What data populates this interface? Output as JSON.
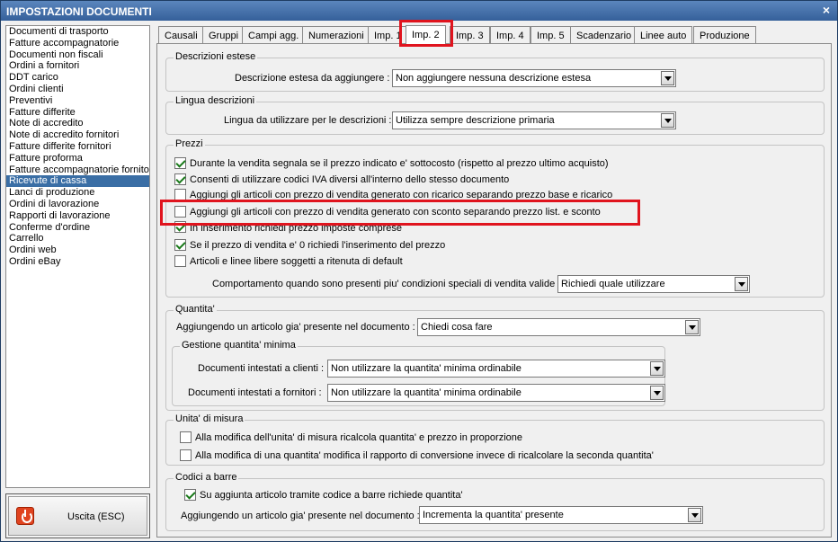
{
  "window": {
    "title": "IMPOSTAZIONI DOCUMENTI",
    "close_glyph": "×"
  },
  "sidebar": {
    "items": [
      "Documenti di trasporto",
      "Fatture accompagnatorie",
      "Documenti non fiscali",
      "Ordini a fornitori",
      "DDT carico",
      "Ordini clienti",
      "Preventivi",
      "Fatture differite",
      "Note di accredito",
      "Note di accredito fornitori",
      "Fatture differite fornitori",
      "Fatture proforma",
      "Fatture accompagnatorie fornito",
      "Ricevute di cassa",
      "Lanci di produzione",
      "Ordini di lavorazione",
      "Rapporti di lavorazione",
      "Conferme d'ordine",
      "Carrello",
      "Ordini web",
      "Ordini eBay"
    ],
    "selected_index": 13
  },
  "exit_button": {
    "label": "Uscita (ESC)",
    "icon": "power-icon"
  },
  "tabs": [
    "Causali",
    "Gruppi",
    "Campi agg.",
    "Numerazioni",
    "Imp. 1",
    "Imp. 2",
    "Imp. 3",
    "Imp. 4",
    "Imp. 5",
    "Scadenzario",
    "Linee auto",
    "Produzione"
  ],
  "active_tab": "Imp. 2",
  "descrizioni_estese": {
    "title": "Descrizioni estese",
    "label": "Descrizione estesa da aggiungere :",
    "value": "Non aggiungere nessuna descrizione estesa"
  },
  "lingua_descrizioni": {
    "title": "Lingua descrizioni",
    "label": "Lingua da utilizzare per le descrizioni :",
    "value": "Utilizza sempre descrizione primaria"
  },
  "prezzi": {
    "title": "Prezzi",
    "checks": [
      {
        "label": "Durante la vendita segnala se il prezzo indicato e' sottocosto (rispetto al prezzo ultimo acquisto)",
        "checked": true
      },
      {
        "label": "Consenti di utilizzare codici IVA diversi all'interno dello stesso documento",
        "checked": true
      },
      {
        "label": "Aggiungi gli articoli con prezzo di vendita generato con ricarico separando prezzo base e ricarico",
        "checked": false
      },
      {
        "label": "Aggiungi gli articoli con prezzo di vendita generato con sconto separando prezzo list. e sconto",
        "checked": false
      },
      {
        "label": "In inserimento richiedi prezzo imposte comprese",
        "checked": true
      },
      {
        "label": "Se il prezzo di vendita e' 0 richiedi l'inserimento del prezzo",
        "checked": true
      },
      {
        "label": "Articoli e linee libere soggetti a ritenuta di default",
        "checked": false
      }
    ],
    "condizioni_label": "Comportamento quando sono presenti piu' condizioni speciali di vendita valide :",
    "condizioni_value": "Richiedi quale utilizzare"
  },
  "quantita": {
    "title": "Quantita'",
    "label": "Aggiungendo un articolo gia' presente nel documento :",
    "value": "Chiedi cosa fare",
    "minima": {
      "title": "Gestione quantita' minima",
      "clienti_label": "Documenti intestati a clienti :",
      "clienti_value": "Non utilizzare la quantita' minima ordinabile",
      "fornitori_label": "Documenti intestati a fornitori :",
      "fornitori_value": "Non utilizzare la quantita' minima ordinabile"
    }
  },
  "unita_misura": {
    "title": "Unita' di misura",
    "checks": [
      {
        "label": "Alla modifica dell'unita' di misura ricalcola quantita' e prezzo in proporzione",
        "checked": false
      },
      {
        "label": "Alla modifica di una quantita' modifica il rapporto di conversione invece di ricalcolare la seconda quantita'",
        "checked": false
      }
    ]
  },
  "codici_barre": {
    "title": "Codici a barre",
    "check": {
      "label": "Su aggiunta articolo tramite codice a barre richiede quantita'",
      "checked": true
    },
    "label": "Aggiungendo un articolo gia' presente nel documento :",
    "value": "Incrementa la quantita' presente"
  },
  "colors": {
    "highlight": "#e0141e",
    "selection": "#3a6ea5",
    "titlebar": "#35609a"
  }
}
